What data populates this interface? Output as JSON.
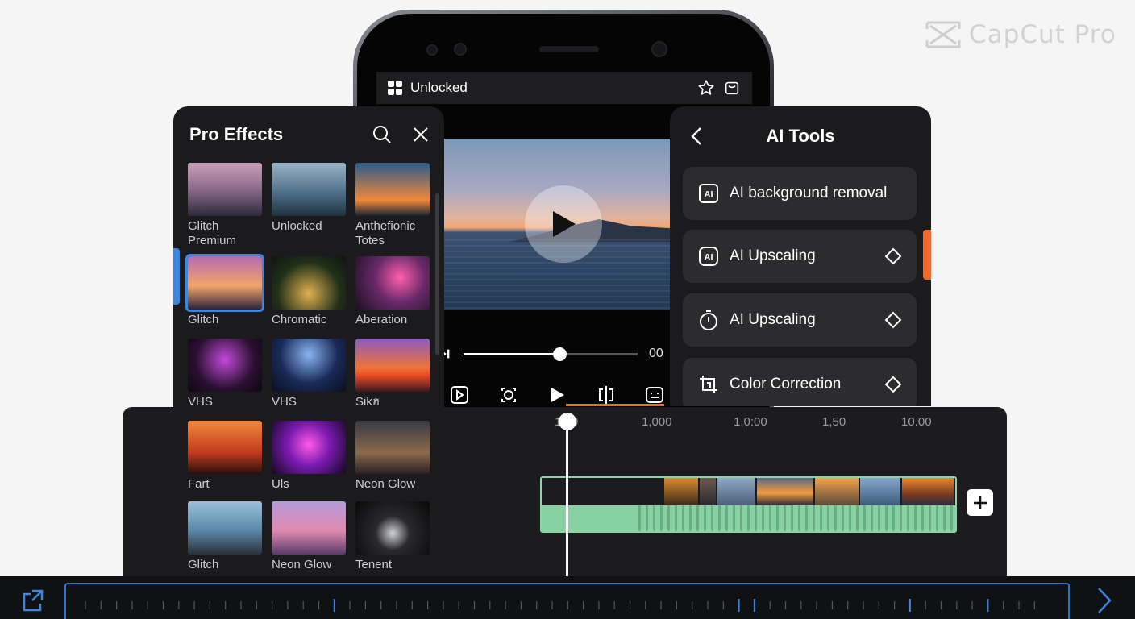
{
  "brand": {
    "name": "CapCut Pro"
  },
  "phone": {
    "top_bar_label": "Unlocked",
    "scrub_time": "00",
    "scrub_progress": 0.55
  },
  "pro_effects": {
    "title": "Pro Effects",
    "items": [
      {
        "label": "Glitch\nPremium",
        "selected": false
      },
      {
        "label": "Unlocked",
        "selected": false
      },
      {
        "label": "Anthefionic\nTotes",
        "selected": false
      },
      {
        "label": "Glitch",
        "selected": true
      },
      {
        "label": "Chromatic",
        "selected": false
      },
      {
        "label": "Aberation",
        "selected": false
      },
      {
        "label": "VHS",
        "selected": false
      },
      {
        "label": "VHS",
        "selected": false
      },
      {
        "label": "Sikฮ",
        "selected": false
      },
      {
        "label": "Fart",
        "selected": false
      },
      {
        "label": "Uls",
        "selected": false
      },
      {
        "label": "Neon Glow",
        "selected": false
      },
      {
        "label": "Glitch",
        "selected": false
      },
      {
        "label": "Neon Glow",
        "selected": false
      },
      {
        "label": "Tenent",
        "selected": false
      }
    ]
  },
  "ai_tools": {
    "title": "AI Tools",
    "items": [
      {
        "label": "AI background removal",
        "icon": "ai-chip-icon"
      },
      {
        "label": "AI Upscaling",
        "icon": "ai-chip-icon"
      },
      {
        "label": "AI Upscaling",
        "icon": "stopwatch-icon"
      },
      {
        "label": "Color Correction",
        "icon": "crop-adjust-icon"
      }
    ]
  },
  "timeline": {
    "ruler": [
      "1.00",
      "1,000",
      "1,0:00",
      "1,50",
      "10.00"
    ]
  },
  "colors": {
    "accent_blue": "#3a86e0",
    "accent_orange": "#f2692b",
    "clip_green": "#86d2a2",
    "panel_bg": "#1b1b1d"
  }
}
